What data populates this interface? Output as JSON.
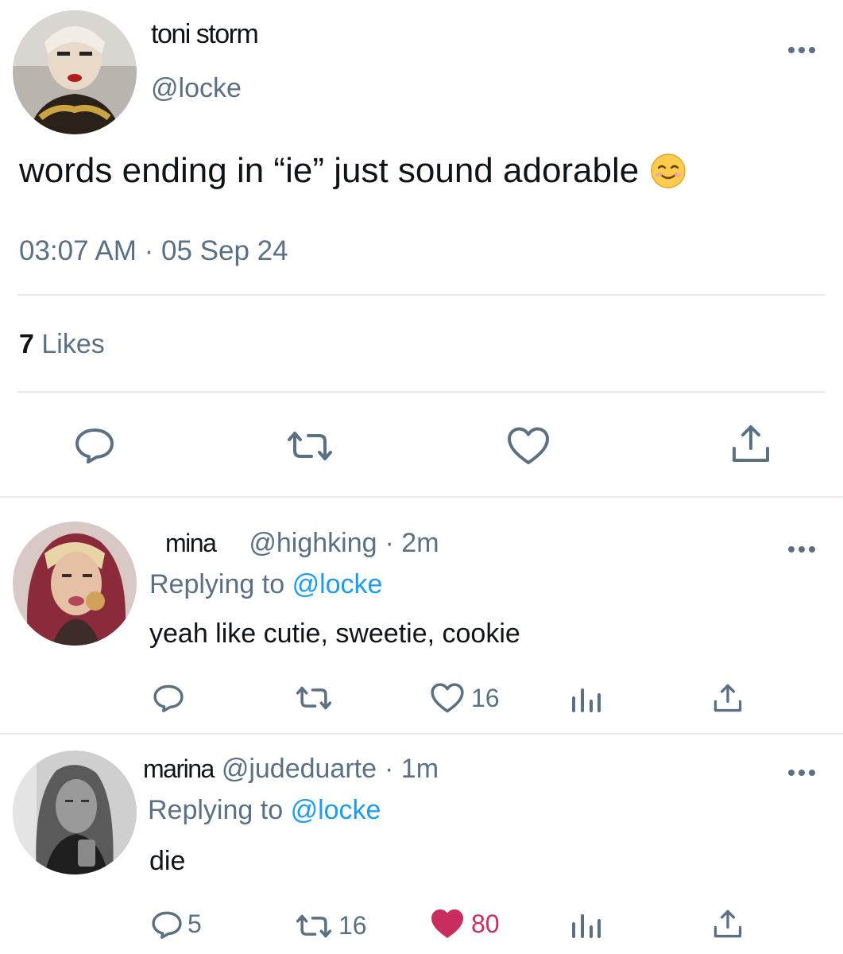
{
  "main_tweet": {
    "display_name": "toni storm",
    "handle": "@locke",
    "text": "words ending in “ie” just sound adorable",
    "emoji": "smiling-face-emoji",
    "time": "03:07 AM",
    "separator": "·",
    "date": "05 Sep 24",
    "likes_count": "7",
    "likes_label": "Likes"
  },
  "replies": [
    {
      "display_name": "mina",
      "handle": "@highking",
      "time": "· 2m",
      "replying_prefix": "Replying to",
      "replying_handle": "@locke",
      "text": "yeah like cutie, sweetie, cookie",
      "reply_count": "",
      "retweet_count": "",
      "like_count": "16",
      "liked": false
    },
    {
      "display_name": "marina",
      "handle": "@judeduarte",
      "time": "· 1m",
      "replying_prefix": "Replying to",
      "replying_handle": "@locke",
      "text": "die",
      "reply_count": "5",
      "retweet_count": "16",
      "like_count": "80",
      "liked": true
    }
  ],
  "colors": {
    "text": "#0f1419",
    "muted": "#5b7083",
    "link": "#1d9bf0",
    "divider": "#e6ecf0",
    "like_active": "#f91880"
  },
  "icons": [
    "more-icon",
    "reply-icon",
    "retweet-icon",
    "like-icon",
    "share-icon",
    "analytics-icon"
  ]
}
